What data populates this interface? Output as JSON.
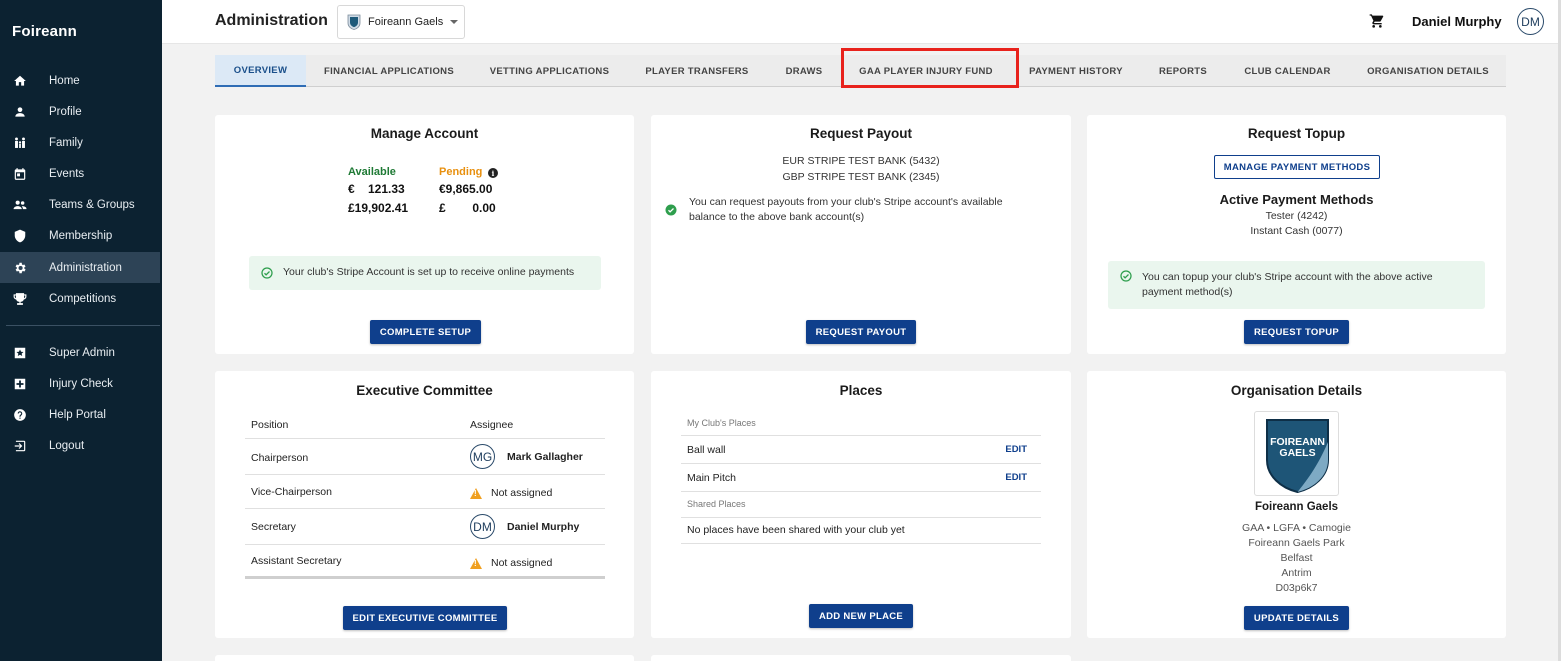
{
  "sidebar": {
    "brand": "Foireann",
    "items": [
      {
        "label": "Home",
        "icon": "home-icon"
      },
      {
        "label": "Profile",
        "icon": "person-icon"
      },
      {
        "label": "Family",
        "icon": "family-icon"
      },
      {
        "label": "Events",
        "icon": "calendar-icon"
      },
      {
        "label": "Teams & Groups",
        "icon": "group-icon"
      },
      {
        "label": "Membership",
        "icon": "shield-icon"
      },
      {
        "label": "Administration",
        "icon": "gear-icon"
      },
      {
        "label": "Competitions",
        "icon": "trophy-icon"
      },
      {
        "label": "Super Admin",
        "icon": "super-admin-icon"
      },
      {
        "label": "Injury Check",
        "icon": "medical-cross-icon"
      },
      {
        "label": "Help Portal",
        "icon": "help-icon"
      },
      {
        "label": "Logout",
        "icon": "logout-icon"
      }
    ],
    "active": "Administration"
  },
  "header": {
    "title": "Administration",
    "org_selected": "Foireann Gaels",
    "user_name": "Daniel Murphy",
    "user_initials": "DM"
  },
  "tabs": [
    {
      "label": "OVERVIEW"
    },
    {
      "label": "FINANCIAL APPLICATIONS"
    },
    {
      "label": "VETTING APPLICATIONS"
    },
    {
      "label": "PLAYER TRANSFERS"
    },
    {
      "label": "DRAWS"
    },
    {
      "label": "GAA PLAYER INJURY FUND"
    },
    {
      "label": "PAYMENT HISTORY"
    },
    {
      "label": "REPORTS"
    },
    {
      "label": "CLUB CALENDAR"
    },
    {
      "label": "ORGANISATION DETAILS"
    }
  ],
  "manage_account": {
    "title": "Manage Account",
    "available_label": "Available",
    "pending_label": "Pending",
    "available": [
      "€    121.33",
      "£19,902.41"
    ],
    "pending": [
      "€9,865.00",
      "£        0.00"
    ],
    "notice": "Your club's Stripe Account is set up to receive online payments",
    "button": "COMPLETE SETUP"
  },
  "request_payout": {
    "title": "Request Payout",
    "banks": [
      "EUR STRIPE TEST BANK (5432)",
      "GBP STRIPE TEST BANK (2345)"
    ],
    "notice": "You can request payouts from your club's Stripe account's available balance to the above bank account(s)",
    "button": "REQUEST PAYOUT"
  },
  "request_topup": {
    "title": "Request Topup",
    "manage_button": "MANAGE PAYMENT METHODS",
    "methods_title": "Active Payment Methods",
    "methods": [
      "Tester (4242)",
      "Instant Cash (0077)"
    ],
    "notice": "You can topup your club's Stripe account with the above active payment method(s)",
    "button": "REQUEST TOPUP"
  },
  "executive": {
    "title": "Executive Committee",
    "col_position": "Position",
    "col_assignee": "Assignee",
    "rows": [
      {
        "position": "Chairperson",
        "initials": "MG",
        "assignee": "Mark Gallagher"
      },
      {
        "position": "Vice-Chairperson",
        "assignee": "Not assigned"
      },
      {
        "position": "Secretary",
        "initials": "DM",
        "assignee": "Daniel Murphy"
      },
      {
        "position": "Assistant Secretary",
        "assignee": "Not assigned"
      }
    ],
    "button": "EDIT EXECUTIVE COMMITTEE"
  },
  "places": {
    "title": "Places",
    "my_places_label": "My Club's Places",
    "my_places": [
      "Ball wall",
      "Main Pitch"
    ],
    "edit_label": "EDIT",
    "shared_label": "Shared Places",
    "shared_empty": "No places have been shared with your club yet",
    "button": "ADD NEW PLACE"
  },
  "org_details": {
    "title": "Organisation Details",
    "logo_text_1": "FOIREANN",
    "logo_text_2": "GAELS",
    "name": "Foireann Gaels",
    "codes": "GAA • LGFA • Camogie",
    "ground": "Foireann Gaels Park",
    "town": "Belfast",
    "county": "Antrim",
    "eircode": "D03p6k7",
    "button": "UPDATE DETAILS"
  },
  "colors": {
    "sidebar_bg": "#0c2231",
    "primary": "#0f3f8c",
    "highlight": "#e8221c",
    "available_green": "#1f7a35",
    "pending_orange": "#e8900f"
  }
}
